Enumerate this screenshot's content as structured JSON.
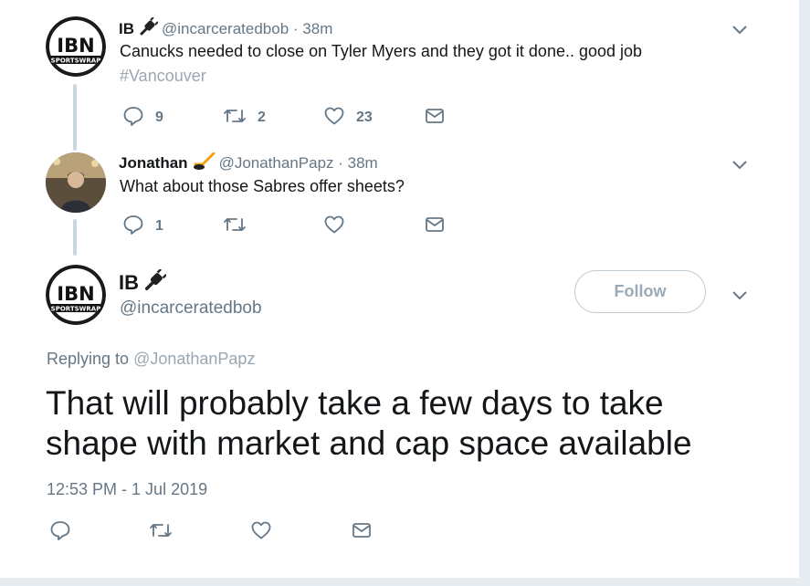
{
  "colors": {
    "icon": "#657786",
    "border": "#ccd6dd",
    "accent_hashtag": "#9aa6b1"
  },
  "tweet1": {
    "avatar_text": "IBN",
    "avatar_sub": "SPORTSWRAP",
    "name": "IB",
    "emoji_icon": "plug-icon",
    "handle": "@incarceratedbob",
    "time": "· 38m",
    "text": "Canucks needed to close on Tyler Myers and they got it done.. good job",
    "hashtag": "#Vancouver",
    "replies": "9",
    "retweets": "2",
    "likes": "23"
  },
  "tweet2": {
    "name": "Jonathan",
    "emoji_icon": "hockey-icon",
    "handle": "@JonathanPapz",
    "time": "· 38m",
    "text": "What about those Sabres offer sheets?",
    "replies": "1",
    "retweets": "",
    "likes": ""
  },
  "main": {
    "avatar_text": "IBN",
    "avatar_sub": "SPORTSWRAP",
    "name": "IB",
    "emoji_icon": "plug-icon",
    "handle": "@incarceratedbob",
    "follow_label": "Follow",
    "replying_prefix": "Replying to",
    "replying_to": "@JonathanPapz",
    "text": "That will probably take a few days to take shape with market and cap space available",
    "timestamp": "12:53 PM - 1 Jul 2019"
  }
}
